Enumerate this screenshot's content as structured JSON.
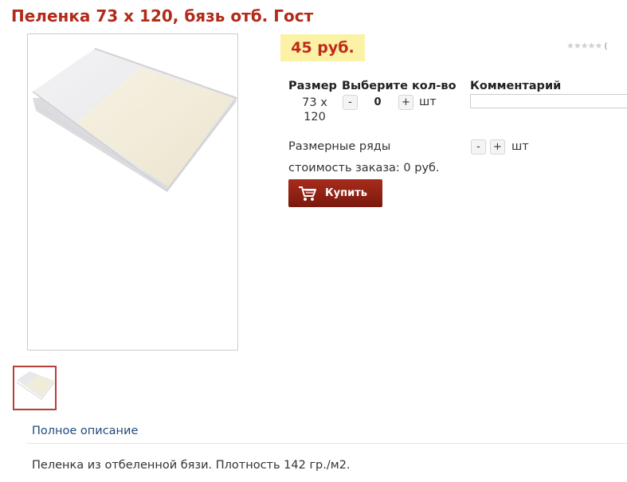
{
  "product": {
    "title": "Пеленка 73 х 120, бязь отб. Гост",
    "price": "45 руб.",
    "rating": {
      "stars": "★★★★★",
      "paren": "(",
      "value": 0
    }
  },
  "order_table": {
    "headers": {
      "size": "Размер",
      "qty": "Выберите кол-во",
      "comment": "Комментарий"
    },
    "row": {
      "size": "73 х 120",
      "minus": "-",
      "qty": "0",
      "plus": "+",
      "unit": "шт",
      "comment_value": ""
    },
    "series": {
      "label": "Размерные ряды",
      "minus": "-",
      "plus": "+",
      "unit": "шт"
    },
    "total": "стоимость заказа: 0 руб."
  },
  "buy_button": {
    "label": "Купить",
    "icon": "cart-icon"
  },
  "tabs": [
    {
      "label": "Полное описание"
    }
  ],
  "description": "Пеленка из отбеленной бязи. Плотность 142 гр./м2.",
  "colors": {
    "title": "#b22a1a",
    "price_bg": "#fbf2a6",
    "price_text": "#c0291a",
    "button": "#9a2416",
    "link": "#1f4a7a"
  }
}
